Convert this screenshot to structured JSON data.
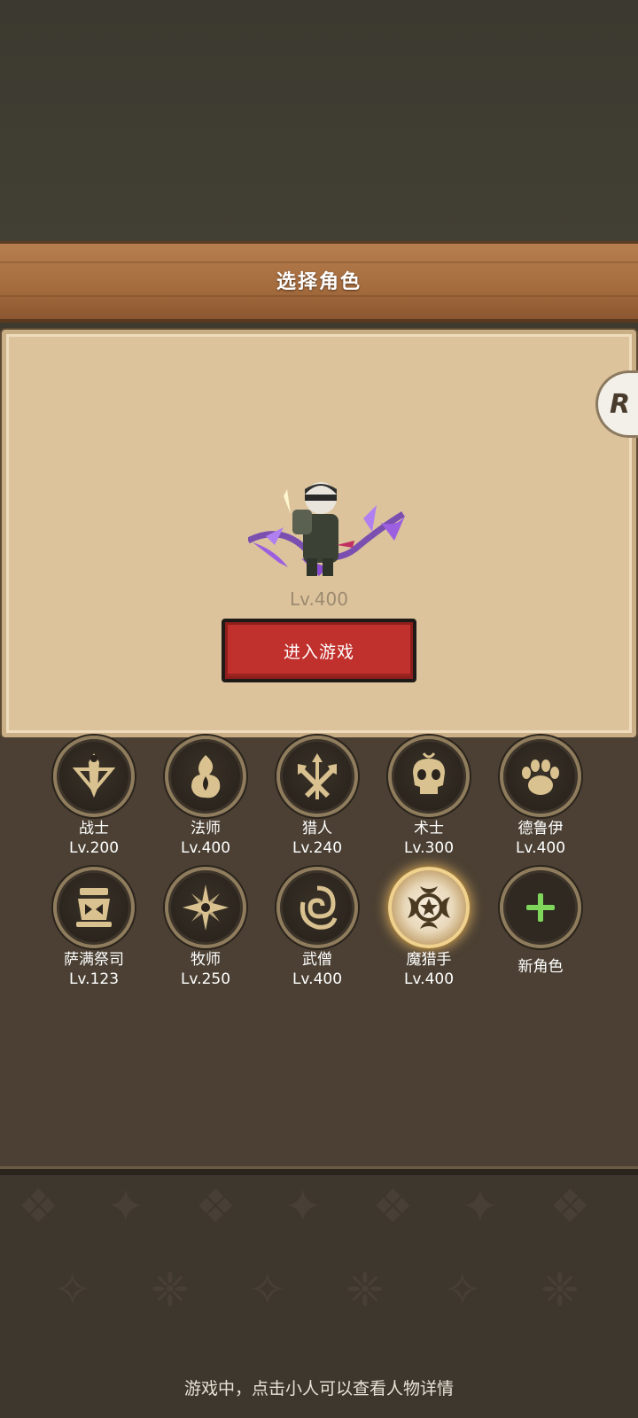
{
  "header": {
    "title": "选择角色"
  },
  "preview": {
    "level": "Lv.400",
    "enter_button": "进入游戏",
    "side_tab_glyph": "R"
  },
  "classes": [
    {
      "name": "战士",
      "level": "Lv.200",
      "icon": "sword-icon"
    },
    {
      "name": "法师",
      "level": "Lv.400",
      "icon": "flame-icon"
    },
    {
      "name": "猎人",
      "level": "Lv.240",
      "icon": "arrows-icon"
    },
    {
      "name": "术士",
      "level": "Lv.300",
      "icon": "skull-icon"
    },
    {
      "name": "德鲁伊",
      "level": "Lv.400",
      "icon": "paw-icon"
    },
    {
      "name": "萨满祭司",
      "level": "Lv.123",
      "icon": "totem-icon"
    },
    {
      "name": "牧师",
      "level": "Lv.250",
      "icon": "star-burst-icon"
    },
    {
      "name": "武僧",
      "level": "Lv.400",
      "icon": "swirl-icon"
    },
    {
      "name": "魔猎手",
      "level": "Lv.400",
      "icon": "demon-star-icon",
      "selected": true
    },
    {
      "name": "新角色",
      "icon": "plus-icon"
    }
  ],
  "footer": {
    "hint": "游戏中，点击小人可以查看人物详情"
  },
  "colors": {
    "accent_gold": "#d9c28f",
    "button_red": "#c0302c",
    "plus_green": "#7ed65a"
  }
}
